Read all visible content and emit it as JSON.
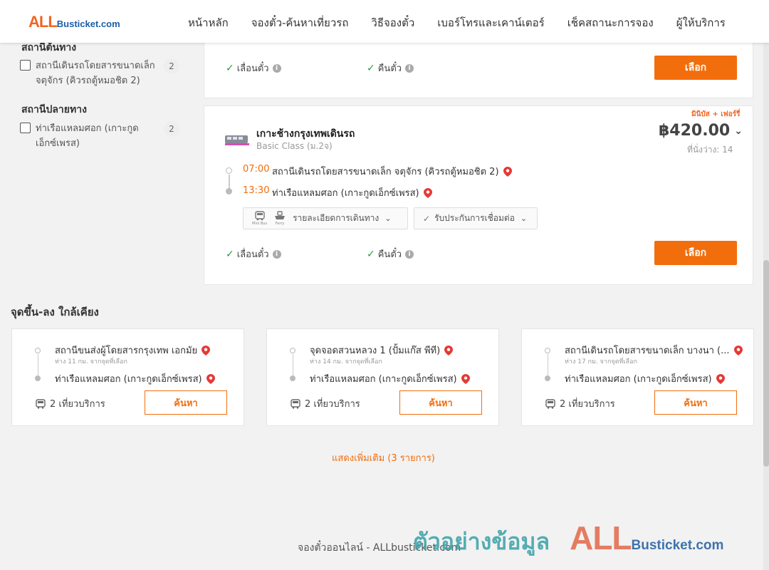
{
  "brand": {
    "logo_all": "ALL",
    "logo_rest": "Busticket.com"
  },
  "nav": [
    "หน้าหลัก",
    "จองตั๋ว-ค้นหาเที่ยวรถ",
    "วิธีจองตั๋ว",
    "เบอร์โทรและเคาน์เตอร์",
    "เช็คสถานะการจอง",
    "ผู้ให้บริการ"
  ],
  "filters": {
    "origin_heading": "สถานีต้นทาง",
    "origin_items": [
      {
        "label": "สถานีเดินรถโดยสารขนาดเล็ก จตุจักร (คิวรถตู้หมอชิต 2)",
        "count": "2"
      }
    ],
    "destination_heading": "สถานีปลายทาง",
    "destination_items": [
      {
        "label": "ท่าเรือแหลมศอก (เกาะกูดเอ็กซ์เพรส)",
        "count": "2"
      }
    ]
  },
  "card_prev": {
    "perk_change": "เลื่อนตั๋ว",
    "perk_refund": "คืนตั๋ว",
    "select_label": "เลือก"
  },
  "trip": {
    "promo": "มินิบัส + เฟอร์รี่",
    "operator": "เกาะช้างกรุงเทพเดินรถ",
    "class": "Basic Class (ม.2จ)",
    "price": "฿420.00",
    "seats": "ที่นั่งว่าง: 14",
    "depart_time": "07:00",
    "depart_station": "สถานีเดินรถโดยสารขนาดเล็ก จตุจักร (คิวรถตู้หมอชิต 2)",
    "arrive_time": "13:30",
    "arrive_station": "ท่าเรือแหลมศอก (เกาะกูดเอ็กซ์เพรส)",
    "vehicle_1": "Mini Bus",
    "vehicle_2": "Ferry",
    "details_label": "รายละเอียดการเดินทาง",
    "guarantee_label": "รับประกันการเชื่อมต่อ",
    "perk_change": "เลื่อนตั๋ว",
    "perk_refund": "คืนตั๋ว",
    "select_label": "เลือก"
  },
  "nearby": {
    "title": "จุดขึ้น-ลง ใกล้เคียง",
    "cards": [
      {
        "from": "สถานีขนส่งผู้โดยสารกรุงเทพ เอกมัย",
        "distance": "ห่าง 11 กม. จากจุดที่เลือก",
        "to": "ท่าเรือแหลมศอก (เกาะกูดเอ็กซ์เพรส)",
        "trips": "2 เที่ยวบริการ",
        "search": "ค้นหา"
      },
      {
        "from": "จุดจอดสวนหลวง 1 (ปั้มแก๊ส พีที)",
        "distance": "ห่าง 14 กม. จากจุดที่เลือก",
        "to": "ท่าเรือแหลมศอก (เกาะกูดเอ็กซ์เพรส)",
        "trips": "2 เที่ยวบริการ",
        "search": "ค้นหา"
      },
      {
        "from": "สถานีเดินรถโดยสารขนาดเล็ก บางนา (...",
        "distance": "ห่าง 17 กม. จากจุดที่เลือก",
        "to": "ท่าเรือแหลมศอก (เกาะกูดเอ็กซ์เพรส)",
        "trips": "2 เที่ยวบริการ",
        "search": "ค้นหา"
      }
    ],
    "show_more": "แสดงเพิ่มเติม (3 รายการ)"
  },
  "footer": {
    "text": "จองตั๋วออนไลน์ - ALLbusticket.com"
  },
  "watermark": {
    "thai": "ตัวอย่างข้อมูล",
    "all": "ALL",
    "rest": "Busticket.com"
  },
  "colors": {
    "accent": "#f26d0c",
    "brand_orange": "#f26522",
    "brand_blue": "#1b5ea8",
    "check_green": "#2f9a3d",
    "pin_red": "#e53935"
  }
}
